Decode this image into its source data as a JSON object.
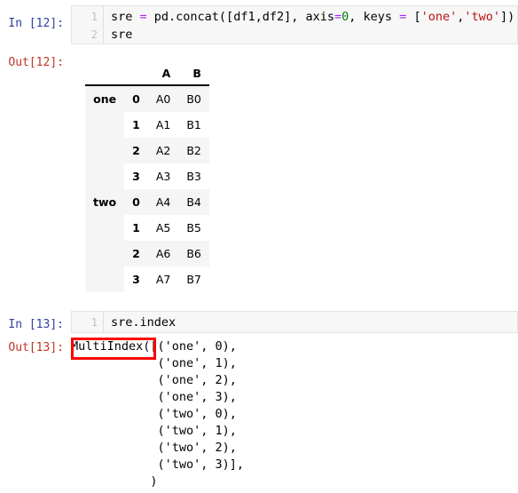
{
  "cells": [
    {
      "prompt_in": "In [12]:",
      "prompt_out": "Out[12]:",
      "code_lines": [
        {
          "no": "1",
          "tokens": [
            {
              "t": "sre ",
              "c": "plain"
            },
            {
              "t": "=",
              "c": "op"
            },
            {
              "t": " pd.concat([df1,df2], axis",
              "c": "plain"
            },
            {
              "t": "=",
              "c": "op"
            },
            {
              "t": "0",
              "c": "num"
            },
            {
              "t": ", keys ",
              "c": "plain"
            },
            {
              "t": "=",
              "c": "op"
            },
            {
              "t": " [",
              "c": "plain"
            },
            {
              "t": "'one'",
              "c": "str"
            },
            {
              "t": ",",
              "c": "plain"
            },
            {
              "t": "'two'",
              "c": "str"
            },
            {
              "t": "])",
              "c": "plain"
            }
          ]
        },
        {
          "no": "2",
          "tokens": [
            {
              "t": "sre",
              "c": "plain"
            }
          ]
        }
      ],
      "table": {
        "corner": "",
        "index_headers": [
          "",
          ""
        ],
        "columns": [
          "A",
          "B"
        ],
        "rows": [
          {
            "lvl0": "one",
            "lvl1": "0",
            "values": [
              "A0",
              "B0"
            ],
            "stripe": "odd"
          },
          {
            "lvl0": "",
            "lvl1": "1",
            "values": [
              "A1",
              "B1"
            ],
            "stripe": "even"
          },
          {
            "lvl0": "",
            "lvl1": "2",
            "values": [
              "A2",
              "B2"
            ],
            "stripe": "odd"
          },
          {
            "lvl0": "",
            "lvl1": "3",
            "values": [
              "A3",
              "B3"
            ],
            "stripe": "even"
          },
          {
            "lvl0": "two",
            "lvl1": "0",
            "values": [
              "A4",
              "B4"
            ],
            "stripe": "odd"
          },
          {
            "lvl0": "",
            "lvl1": "1",
            "values": [
              "A5",
              "B5"
            ],
            "stripe": "even"
          },
          {
            "lvl0": "",
            "lvl1": "2",
            "values": [
              "A6",
              "B6"
            ],
            "stripe": "odd"
          },
          {
            "lvl0": "",
            "lvl1": "3",
            "values": [
              "A7",
              "B7"
            ],
            "stripe": "even"
          }
        ]
      }
    },
    {
      "prompt_in": "In [13]:",
      "prompt_out": "Out[13]:",
      "code_lines": [
        {
          "no": "1",
          "tokens": [
            {
              "t": "sre.index",
              "c": "plain"
            }
          ]
        }
      ],
      "text_output": "MultiIndex([('one', 0),\n            ('one', 1),\n            ('one', 2),\n            ('one', 3),\n            ('two', 0),\n            ('two', 1),\n            ('two', 2),\n            ('two', 3)],\n           )"
    }
  ],
  "annotation": {
    "label": "MultiIndex",
    "color": "#ff0000"
  }
}
